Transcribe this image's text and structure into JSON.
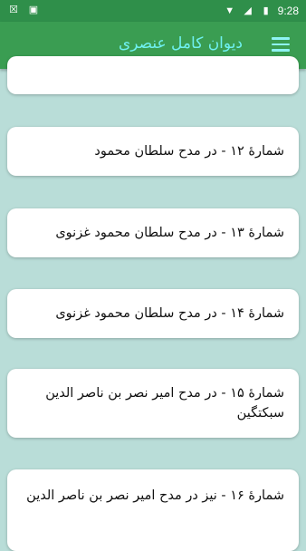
{
  "status": {
    "time": "9:28",
    "icons_left": [
      "close-box-icon",
      "image-icon"
    ],
    "icons_right": [
      "wifi-icon",
      "signal-icon",
      "battery-icon"
    ]
  },
  "appbar": {
    "title": "دیوان کامل عنصری"
  },
  "items": [
    {
      "label": ""
    },
    {
      "label": "شمارهٔ ۱۲ -  در مدح سلطان محمود"
    },
    {
      "label": "شمارهٔ ۱۳ -  در مدح سلطان محمود غزنوی"
    },
    {
      "label": "شمارهٔ ۱۴ -  در مدح سلطان محمود غزنوی"
    },
    {
      "label": "شمارهٔ ۱۵ -  در مدح امیر نصر بن ناصر الدین سبکتگین"
    },
    {
      "label": "شمارهٔ ۱۶ -  نیز در مدح امیر نصر بن ناصر الدین"
    }
  ]
}
